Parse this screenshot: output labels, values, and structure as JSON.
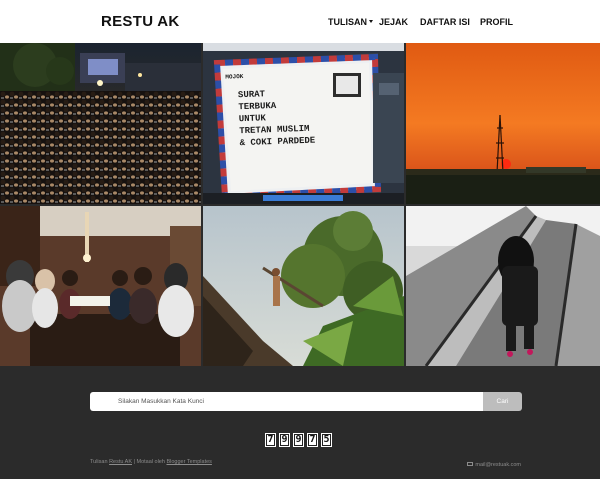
{
  "header": {
    "brand": "RESTU AK",
    "nav": [
      {
        "label": "TULISAN",
        "has_dropdown": true
      },
      {
        "label": "JEJAK",
        "has_dropdown": false
      },
      {
        "label": "DAFTAR ISI",
        "has_dropdown": false
      },
      {
        "label": "PROFIL",
        "has_dropdown": false
      }
    ]
  },
  "gallery": {
    "photos": [
      {
        "subject": "crowd at night event"
      },
      {
        "subject": "laptop screen with airmail letter",
        "letter_lines": [
          "MOJOK",
          "SURAT",
          "TERBUKA",
          "UNTUK",
          "TRETAN MUSLIM",
          "& COKI PARDEDE"
        ]
      },
      {
        "subject": "sunset with transmission tower"
      },
      {
        "subject": "group photo around table"
      },
      {
        "subject": "man on tree branch among banana leaves"
      },
      {
        "subject": "woman on escalator"
      }
    ]
  },
  "footer": {
    "search_placeholder": "Silakan Masukkan Kata Kunci",
    "search_button": "Cari",
    "counter_digits": [
      "7",
      "9",
      "9",
      "7",
      "5"
    ],
    "credit_prefix": "Tulisan",
    "credit_author": "Restu AK",
    "credit_middle": "| Motaal oleh",
    "credit_templates": "Blogger Templates",
    "email": "mail@restuak.com"
  },
  "colors": {
    "header_bg": "#ffffff",
    "footer_bg": "#2b2b2b",
    "search_button_bg": "#bdbdbd"
  }
}
